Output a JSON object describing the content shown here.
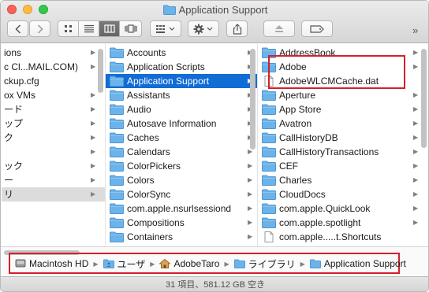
{
  "window": {
    "title": "Application Support",
    "overflow_glyph": "»",
    "colors": {
      "selection": "#116cd6",
      "highlight_box": "#d4202a",
      "folder": "#6cb3ea"
    }
  },
  "toolbar": {
    "buttons": [
      "back-icon",
      "forward-icon",
      "icon-view-icon",
      "list-view-icon",
      "column-view-icon",
      "cover-flow-icon",
      "arrange-icon",
      "action-gear-icon",
      "share-icon",
      "eject-icon",
      "tag-icon"
    ]
  },
  "column1": {
    "items": [
      {
        "label": "ions",
        "arrow": true
      },
      {
        "label": "c Cl...MAIL.COM)",
        "arrow": true
      },
      {
        "label": "ckup.cfg",
        "arrow": false
      },
      {
        "label": "ox VMs",
        "arrow": true
      },
      {
        "label": "ード",
        "arrow": true
      },
      {
        "label": "ップ",
        "arrow": true
      },
      {
        "label": "ク",
        "arrow": true
      },
      {
        "label": "",
        "arrow": true
      },
      {
        "label": "ック",
        "arrow": true
      },
      {
        "label": "ー",
        "arrow": true
      },
      {
        "label": "リ",
        "arrow": true,
        "state": "gray"
      },
      {
        "label": "",
        "arrow": false
      },
      {
        "label": "",
        "arrow": false
      }
    ]
  },
  "column2": {
    "items": [
      {
        "label": "Accounts",
        "icon": "folder",
        "arrow": true
      },
      {
        "label": "Application Scripts",
        "icon": "folder",
        "arrow": true
      },
      {
        "label": "Application Support",
        "icon": "folder",
        "arrow": true,
        "state": "selected"
      },
      {
        "label": "Assistants",
        "icon": "folder",
        "arrow": true
      },
      {
        "label": "Audio",
        "icon": "folder",
        "arrow": true
      },
      {
        "label": "Autosave Information",
        "icon": "folder",
        "arrow": true
      },
      {
        "label": "Caches",
        "icon": "folder",
        "arrow": true
      },
      {
        "label": "Calendars",
        "icon": "folder",
        "arrow": true
      },
      {
        "label": "ColorPickers",
        "icon": "folder",
        "arrow": true
      },
      {
        "label": "Colors",
        "icon": "folder",
        "arrow": true
      },
      {
        "label": "ColorSync",
        "icon": "folder",
        "arrow": true
      },
      {
        "label": "com.apple.nsurlsessiond",
        "icon": "folder",
        "arrow": true
      },
      {
        "label": "Compositions",
        "icon": "folder",
        "arrow": true
      },
      {
        "label": "Containers",
        "icon": "folder",
        "arrow": true
      }
    ]
  },
  "column3": {
    "items": [
      {
        "label": "AddressBook",
        "icon": "folder",
        "arrow": true
      },
      {
        "label": "Adobe",
        "icon": "folder",
        "arrow": true
      },
      {
        "label": "AdobeWLCMCache.dat",
        "icon": "file",
        "arrow": false
      },
      {
        "label": "Aperture",
        "icon": "folder",
        "arrow": true
      },
      {
        "label": "App Store",
        "icon": "folder",
        "arrow": true
      },
      {
        "label": "Avatron",
        "icon": "folder",
        "arrow": true
      },
      {
        "label": "CallHistoryDB",
        "icon": "folder",
        "arrow": true
      },
      {
        "label": "CallHistoryTransactions",
        "icon": "folder",
        "arrow": true
      },
      {
        "label": "CEF",
        "icon": "folder",
        "arrow": true
      },
      {
        "label": "Charles",
        "icon": "folder",
        "arrow": true
      },
      {
        "label": "CloudDocs",
        "icon": "folder",
        "arrow": true
      },
      {
        "label": "com.apple.QuickLook",
        "icon": "folder",
        "arrow": true
      },
      {
        "label": "com.apple.spotlight",
        "icon": "folder",
        "arrow": true
      },
      {
        "label": "com.apple.....t.Shortcuts",
        "icon": "file",
        "arrow": false
      }
    ]
  },
  "pathbar": {
    "crumbs": [
      {
        "label": "Macintosh HD",
        "icon": "harddisk-icon"
      },
      {
        "label": "ユーザ",
        "icon": "users-folder-icon"
      },
      {
        "label": "AdobeTaro",
        "icon": "home-icon"
      },
      {
        "label": "ライブラリ",
        "icon": "folder-icon"
      },
      {
        "label": "Application Support",
        "icon": "folder-icon"
      }
    ]
  },
  "status": {
    "text": "31 項目、581.12 GB 空き"
  }
}
